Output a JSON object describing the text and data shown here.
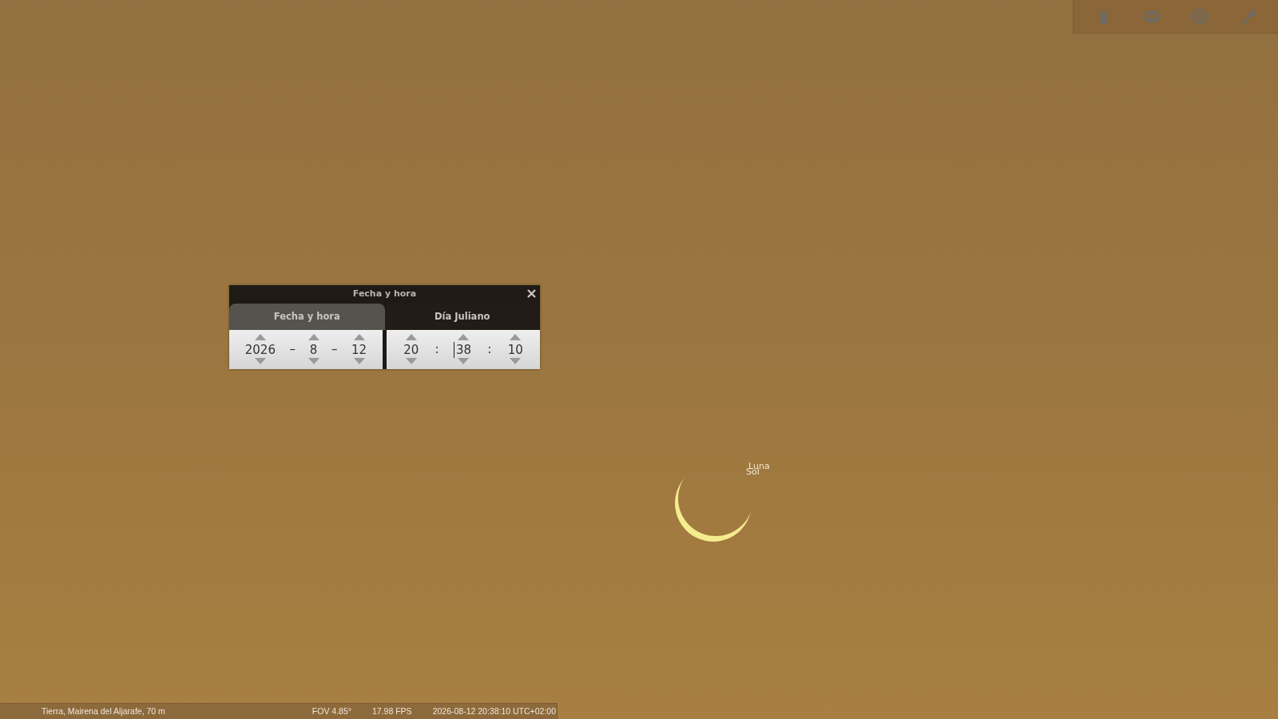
{
  "dialog": {
    "title": "Fecha y hora",
    "tabs": [
      {
        "label": "Fecha y hora",
        "selected": true
      },
      {
        "label": "Día Juliano",
        "selected": false
      }
    ],
    "date_fields": [
      {
        "kind": "spin",
        "value": "2026",
        "focused": false
      },
      {
        "kind": "sep",
        "text": "–"
      },
      {
        "kind": "spin",
        "value": "8",
        "focused": false
      },
      {
        "kind": "sep",
        "text": "–"
      },
      {
        "kind": "spin",
        "value": "12",
        "focused": false
      }
    ],
    "time_fields": [
      {
        "kind": "spin",
        "value": "20",
        "focused": false
      },
      {
        "kind": "sep",
        "text": ":"
      },
      {
        "kind": "spin",
        "value": "38",
        "focused": true
      },
      {
        "kind": "sep",
        "text": ":"
      },
      {
        "kind": "spin",
        "value": "10",
        "focused": false
      }
    ]
  },
  "sky_labels": [
    {
      "text": "Luna"
    },
    {
      "text": "Sol"
    }
  ],
  "status_bar": {
    "location": "Tierra, Mairena del Aljarafe, 70 m",
    "fov": "FOV 4.85°",
    "fps": "17.98 FPS",
    "datetime": "2026-08-12 20:38:10 UTC+02:00"
  }
}
